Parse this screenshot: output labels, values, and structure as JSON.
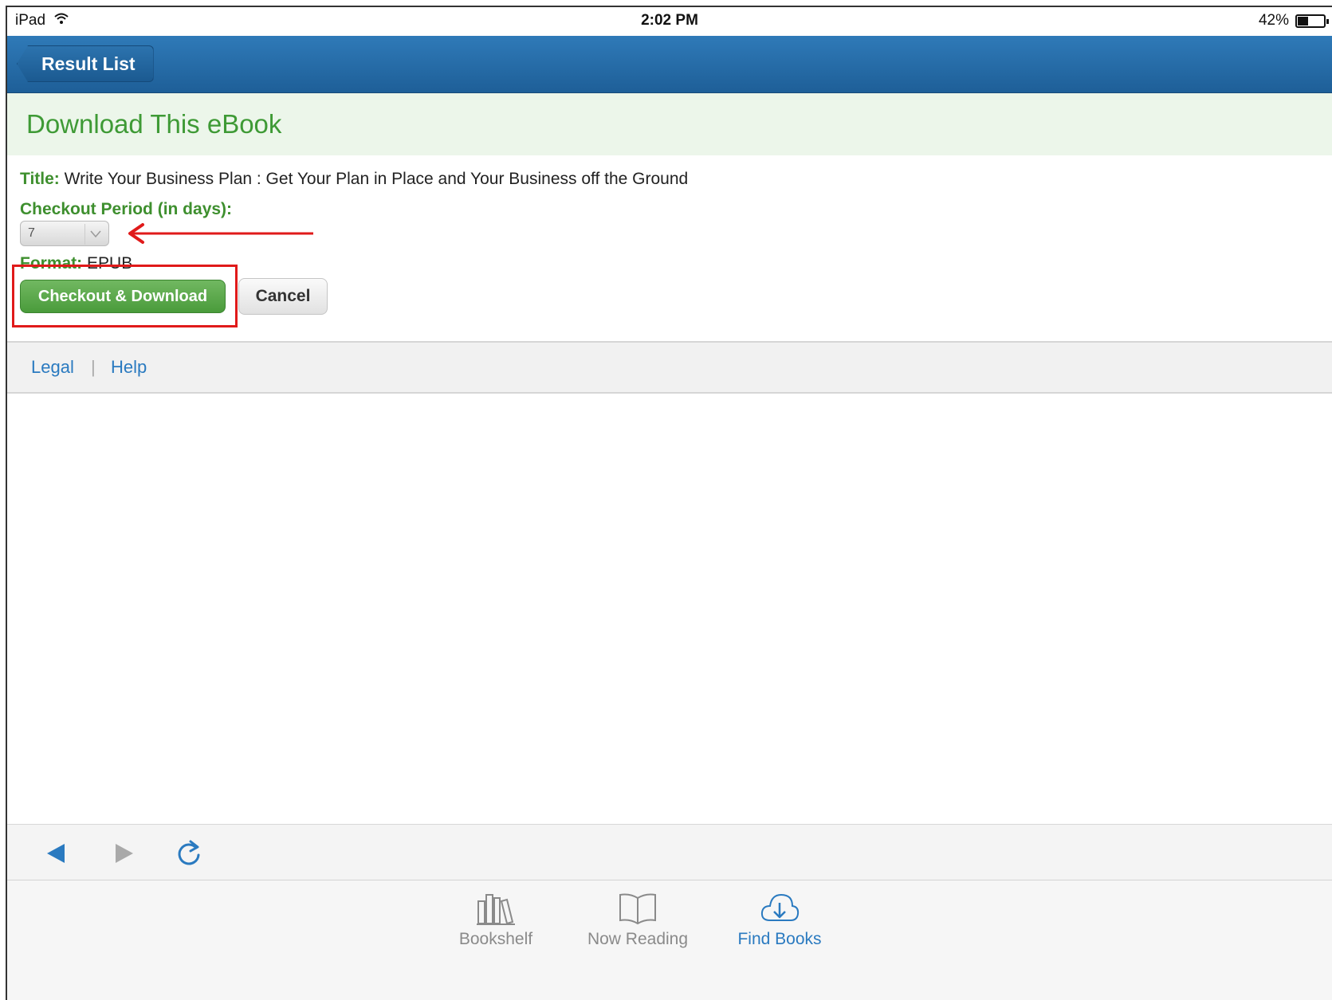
{
  "status_bar": {
    "device": "iPad",
    "time": "2:02 PM",
    "battery_text": "42%",
    "battery_level": 0.42
  },
  "nav": {
    "back_label": "Result List"
  },
  "page": {
    "title": "Download This eBook"
  },
  "details": {
    "title_label": "Title:",
    "title_value": "Write Your Business Plan : Get Your Plan in Place and Your Business off the Ground",
    "checkout_label": "Checkout Period (in days):",
    "checkout_value": "7",
    "format_label": "Format:",
    "format_value": "EPUB"
  },
  "actions": {
    "checkout_download_label": "Checkout & Download",
    "cancel_label": "Cancel"
  },
  "footer": {
    "legal_label": "Legal",
    "separator": "|",
    "help_label": "Help"
  },
  "browser_toolbar": {
    "back_icon": "back-arrow-icon",
    "forward_icon": "forward-arrow-icon",
    "reload_icon": "reload-icon"
  },
  "tabs": [
    {
      "label": "Bookshelf",
      "icon": "bookshelf-icon",
      "active": false
    },
    {
      "label": "Now Reading",
      "icon": "open-book-icon",
      "active": false
    },
    {
      "label": "Find Books",
      "icon": "cloud-download-icon",
      "active": true
    }
  ],
  "colors": {
    "nav_blue": "#1e5f98",
    "accent_green": "#3e9a35",
    "link_blue": "#2a7ac0",
    "annotation_red": "#e01a1a"
  }
}
